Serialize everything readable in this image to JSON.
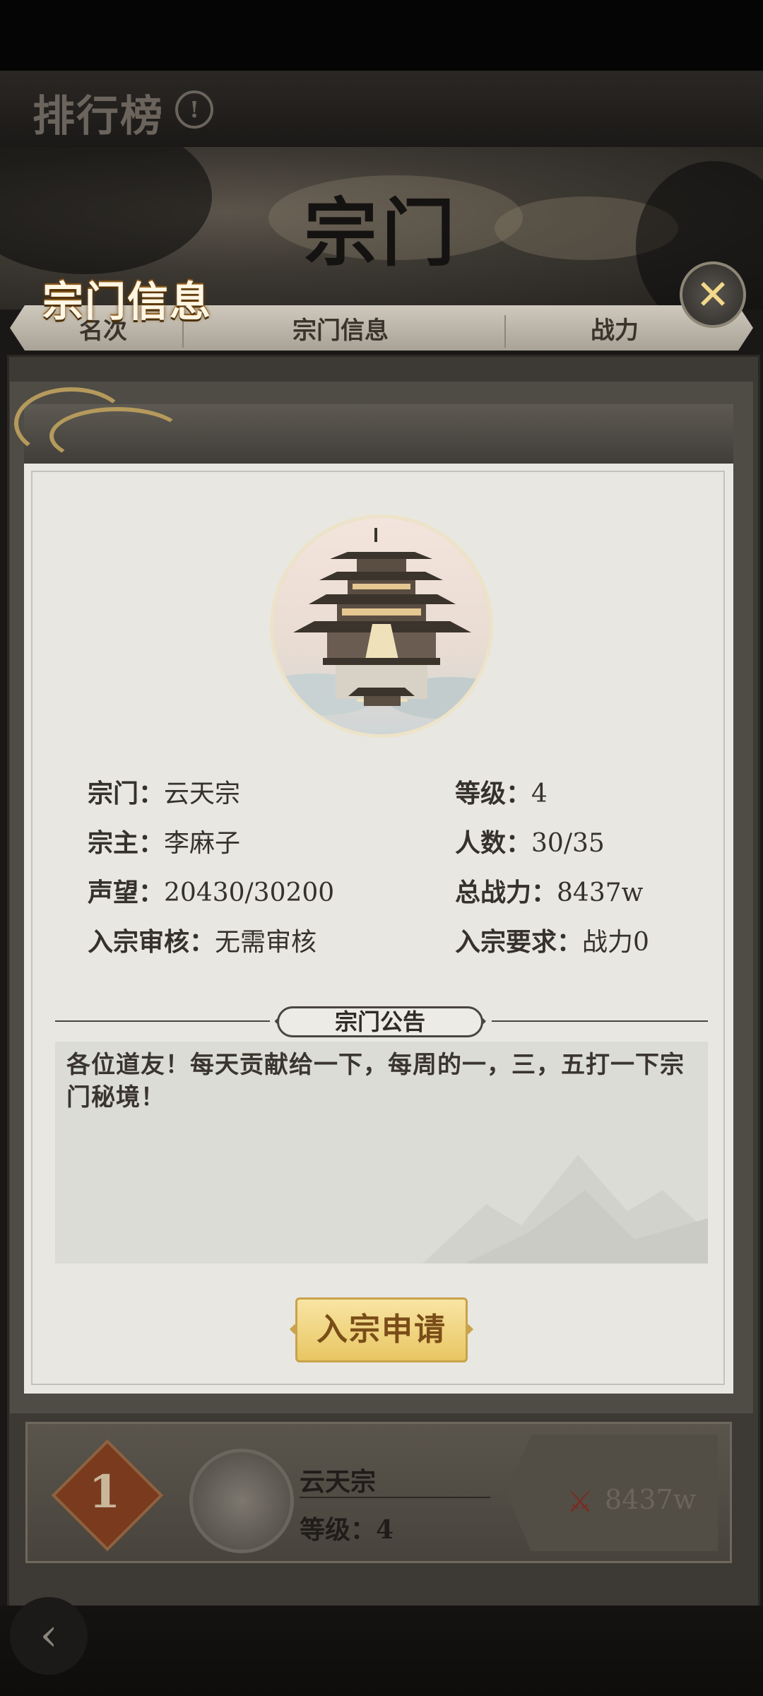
{
  "background": {
    "leaderboard_title": "排行榜",
    "info_icon_glyph": "!",
    "tab_title": "宗门",
    "columns": [
      "名次",
      "宗门信息",
      "战力"
    ],
    "rank_row": {
      "rank": "1",
      "sect_name": "云天宗",
      "level": "等级：4",
      "power": "8437w",
      "sword_icon": "⚔"
    },
    "back_icon": "‹"
  },
  "modal": {
    "title": "宗门信息",
    "close_icon": "✕",
    "info": {
      "sect_label": "宗门：",
      "sect_value": "云天宗",
      "level_label": "等级：",
      "level_value": "4",
      "leader_label": "宗主：",
      "leader_value": "李麻子",
      "members_label": "人数：",
      "members_value": "30/35",
      "prestige_label": "声望：",
      "prestige_value": "20430/30200",
      "power_label": "总战力：",
      "power_value": "8437w",
      "review_label": "入宗审核：",
      "review_value": "无需审核",
      "requirement_label": "入宗要求：",
      "requirement_value": "战力0"
    },
    "notice_title": "宗门公告",
    "notice_text": "各位道友！每天贡献给一下，每周的一，三，五打一下宗门秘境！",
    "apply_button": "入宗申请"
  },
  "colors": {
    "gold": "#e8c662",
    "paper": "#e8e7e2",
    "text": "#36312b"
  }
}
